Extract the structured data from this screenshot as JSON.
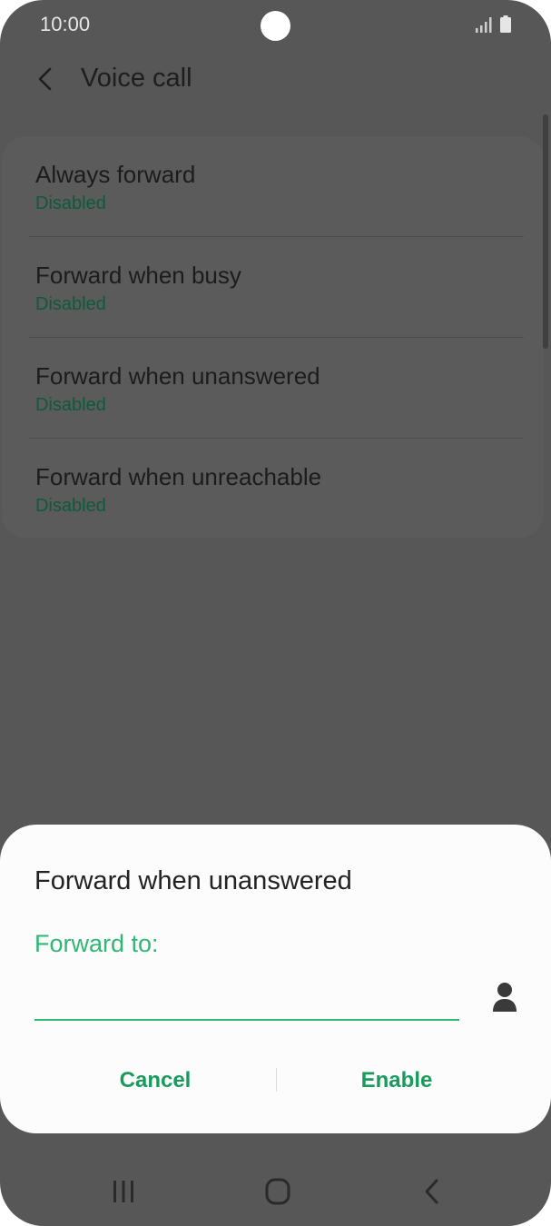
{
  "status_bar": {
    "time": "10:00"
  },
  "header": {
    "title": "Voice call"
  },
  "settings": [
    {
      "label": "Always forward",
      "status": "Disabled"
    },
    {
      "label": "Forward when busy",
      "status": "Disabled"
    },
    {
      "label": "Forward when unanswered",
      "status": "Disabled"
    },
    {
      "label": "Forward when unreachable",
      "status": "Disabled"
    }
  ],
  "dialog": {
    "title": "Forward when unanswered",
    "field_label": "Forward to:",
    "field_value": "",
    "cancel_label": "Cancel",
    "enable_label": "Enable"
  },
  "colors": {
    "accent": "#2eb872",
    "status_text": "#0e5a3c",
    "scrim": "#575757"
  }
}
